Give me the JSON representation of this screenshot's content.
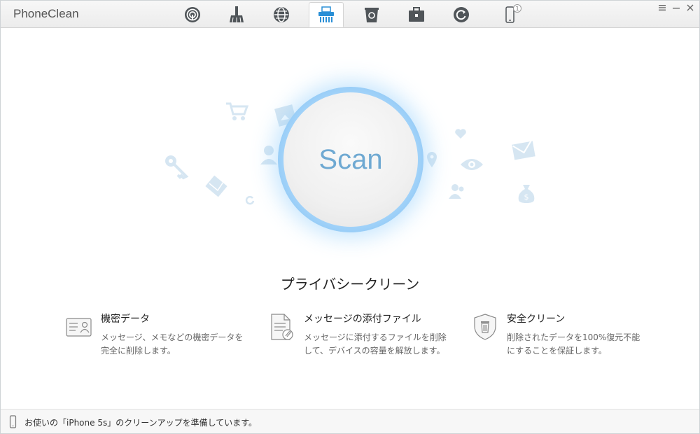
{
  "app": {
    "title": "PhoneClean"
  },
  "toolbar": {
    "tabs": [
      {
        "name": "quick-clean",
        "icon": "radar-icon",
        "active": false
      },
      {
        "name": "deep-clean",
        "icon": "broom-icon",
        "active": false
      },
      {
        "name": "internet-clean",
        "icon": "globe-icon",
        "active": false
      },
      {
        "name": "privacy-clean",
        "icon": "shredder-icon",
        "active": true
      },
      {
        "name": "silent-clean",
        "icon": "trash-icon",
        "active": false
      },
      {
        "name": "toolbox",
        "icon": "briefcase-icon",
        "active": false
      },
      {
        "name": "history",
        "icon": "refresh-icon",
        "active": false
      },
      {
        "name": "device",
        "icon": "phone-icon",
        "badge": "1",
        "active": false
      }
    ],
    "window_controls": [
      "menu-icon",
      "minimize-icon",
      "close-icon"
    ],
    "accent": "#2a8fd6"
  },
  "scan": {
    "label": "Scan"
  },
  "mode": {
    "title": "プライバシークリーン"
  },
  "features": [
    {
      "icon": "id-card-icon",
      "title": "機密データ",
      "line1": "メッセージ、メモなどの機密データを",
      "line2": "完全に削除します。"
    },
    {
      "icon": "document-attachment-icon",
      "title": "メッセージの添付ファイル",
      "line1": "メッセージに添付するファイルを削除",
      "line2": "して、デバイスの容量を解放します。"
    },
    {
      "icon": "shield-trash-icon",
      "title": "安全クリーン",
      "line1": "削除されたデータを100%復元不能",
      "line2": "にすることを保証します。"
    }
  ],
  "status": {
    "text": "お使いの「iPhone 5s」のクリーンアップを準備しています。"
  }
}
